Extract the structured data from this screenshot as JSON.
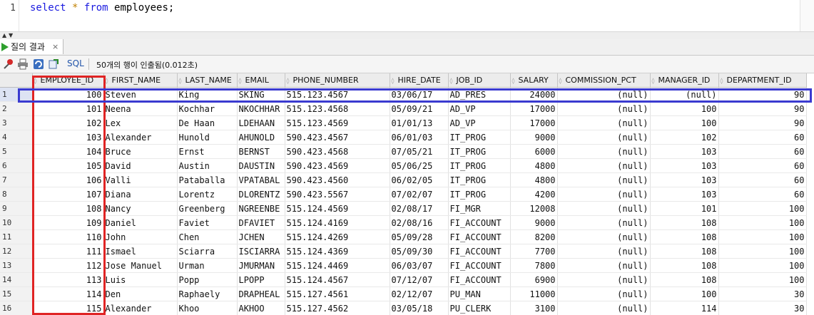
{
  "editor": {
    "line_number": "1",
    "sql": {
      "kw1": "select",
      "star": "*",
      "kw2": "from",
      "table": "employees;"
    }
  },
  "results_tab": {
    "label": "질의 결과",
    "close": "×"
  },
  "toolbar": {
    "icons": [
      "pin-icon",
      "print-icon",
      "refresh-icon",
      "export-icon"
    ],
    "sql_label": "SQL",
    "status": "50개의 행이 인출됨(0.012초)"
  },
  "colors": {
    "highlight_column": "#e02424",
    "highlight_row": "#3a3ad0",
    "run_icon": "#2ea02e"
  },
  "grid": {
    "columns": [
      "EMPLOYEE_ID",
      "FIRST_NAME",
      "LAST_NAME",
      "EMAIL",
      "PHONE_NUMBER",
      "HIRE_DATE",
      "JOB_ID",
      "SALARY",
      "COMMISSION_PCT",
      "MANAGER_ID",
      "DEPARTMENT_ID"
    ],
    "rows": [
      [
        "1",
        "100",
        "Steven",
        "King",
        "SKING",
        "515.123.4567",
        "03/06/17",
        "AD_PRES",
        "24000",
        "(null)",
        "(null)",
        "90"
      ],
      [
        "2",
        "101",
        "Neena",
        "Kochhar",
        "NKOCHHAR",
        "515.123.4568",
        "05/09/21",
        "AD_VP",
        "17000",
        "(null)",
        "100",
        "90"
      ],
      [
        "3",
        "102",
        "Lex",
        "De Haan",
        "LDEHAAN",
        "515.123.4569",
        "01/01/13",
        "AD_VP",
        "17000",
        "(null)",
        "100",
        "90"
      ],
      [
        "4",
        "103",
        "Alexander",
        "Hunold",
        "AHUNOLD",
        "590.423.4567",
        "06/01/03",
        "IT_PROG",
        "9000",
        "(null)",
        "102",
        "60"
      ],
      [
        "5",
        "104",
        "Bruce",
        "Ernst",
        "BERNST",
        "590.423.4568",
        "07/05/21",
        "IT_PROG",
        "6000",
        "(null)",
        "103",
        "60"
      ],
      [
        "6",
        "105",
        "David",
        "Austin",
        "DAUSTIN",
        "590.423.4569",
        "05/06/25",
        "IT_PROG",
        "4800",
        "(null)",
        "103",
        "60"
      ],
      [
        "7",
        "106",
        "Valli",
        "Pataballa",
        "VPATABAL",
        "590.423.4560",
        "06/02/05",
        "IT_PROG",
        "4800",
        "(null)",
        "103",
        "60"
      ],
      [
        "8",
        "107",
        "Diana",
        "Lorentz",
        "DLORENTZ",
        "590.423.5567",
        "07/02/07",
        "IT_PROG",
        "4200",
        "(null)",
        "103",
        "60"
      ],
      [
        "9",
        "108",
        "Nancy",
        "Greenberg",
        "NGREENBE",
        "515.124.4569",
        "02/08/17",
        "FI_MGR",
        "12008",
        "(null)",
        "101",
        "100"
      ],
      [
        "10",
        "109",
        "Daniel",
        "Faviet",
        "DFAVIET",
        "515.124.4169",
        "02/08/16",
        "FI_ACCOUNT",
        "9000",
        "(null)",
        "108",
        "100"
      ],
      [
        "11",
        "110",
        "John",
        "Chen",
        "JCHEN",
        "515.124.4269",
        "05/09/28",
        "FI_ACCOUNT",
        "8200",
        "(null)",
        "108",
        "100"
      ],
      [
        "12",
        "111",
        "Ismael",
        "Sciarra",
        "ISCIARRA",
        "515.124.4369",
        "05/09/30",
        "FI_ACCOUNT",
        "7700",
        "(null)",
        "108",
        "100"
      ],
      [
        "13",
        "112",
        "Jose Manuel",
        "Urman",
        "JMURMAN",
        "515.124.4469",
        "06/03/07",
        "FI_ACCOUNT",
        "7800",
        "(null)",
        "108",
        "100"
      ],
      [
        "14",
        "113",
        "Luis",
        "Popp",
        "LPOPP",
        "515.124.4567",
        "07/12/07",
        "FI_ACCOUNT",
        "6900",
        "(null)",
        "108",
        "100"
      ],
      [
        "15",
        "114",
        "Den",
        "Raphaely",
        "DRAPHEAL",
        "515.127.4561",
        "02/12/07",
        "PU_MAN",
        "11000",
        "(null)",
        "100",
        "30"
      ],
      [
        "16",
        "115",
        "Alexander",
        "Khoo",
        "AKHOO",
        "515.127.4562",
        "03/05/18",
        "PU_CLERK",
        "3100",
        "(null)",
        "114",
        "30"
      ]
    ]
  }
}
